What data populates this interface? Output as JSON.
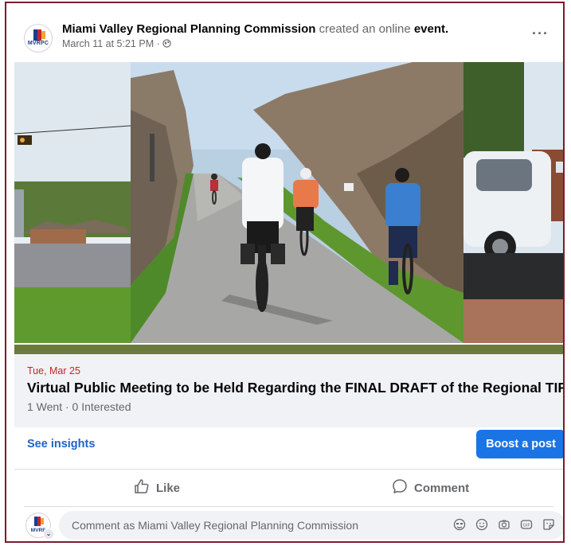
{
  "post": {
    "author": "Miami Valley Regional Planning Commission",
    "action_text": "created an online",
    "action_object": "event.",
    "timestamp": "March 11 at 5:21 PM",
    "privacy_icon": "globe-icon",
    "more_icon": "more-horizontal-icon",
    "logo_text": "MVRPC"
  },
  "event": {
    "date": "Tue, Mar 25",
    "title": "Virtual Public Meeting to be Held Regarding the FINAL DRAFT of the Regional TIP",
    "stats": "1 Went · 0 Interested"
  },
  "footer": {
    "see_insights": "See insights",
    "boost_label": "Boost a post"
  },
  "actions": {
    "like": "Like",
    "comment": "Comment"
  },
  "composer": {
    "placeholder": "Comment as Miami Valley Regional Planning Commission",
    "logo_text": "MVRF",
    "icons": [
      "avatar-sticker-icon",
      "emoji-icon",
      "camera-icon",
      "gif-icon",
      "sticker-icon"
    ]
  },
  "colors": {
    "accent_blue": "#1b74e4",
    "link_blue": "#1e64c8",
    "event_date_red": "#c4252b",
    "frame_border": "#7b1c2e"
  }
}
